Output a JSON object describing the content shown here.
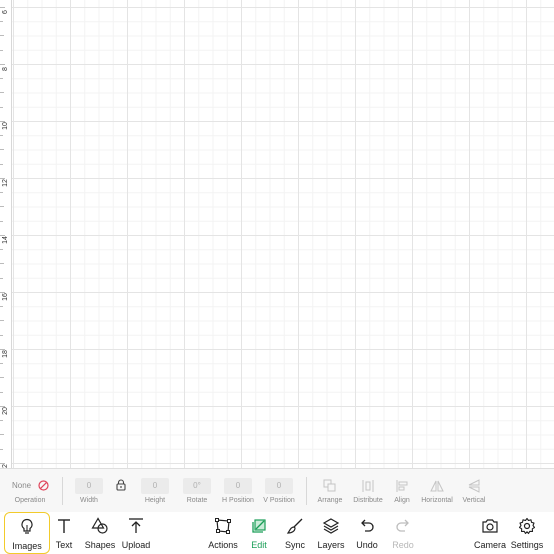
{
  "ruler": {
    "labels": [
      "6",
      "8",
      "10",
      "12",
      "14",
      "16",
      "18",
      "20",
      "2"
    ]
  },
  "properties": {
    "operation": {
      "value": "None",
      "label": "Operation"
    },
    "width": {
      "value": "0",
      "label": "Width"
    },
    "height": {
      "value": "0",
      "label": "Height"
    },
    "rotate": {
      "value": "0°",
      "label": "Rotate"
    },
    "h_position": {
      "value": "0",
      "label": "H Position"
    },
    "v_position": {
      "value": "0",
      "label": "V Position"
    },
    "arrange": {
      "label": "Arrange"
    },
    "distribute": {
      "label": "Distribute"
    },
    "align": {
      "label": "Align"
    },
    "horizontal": {
      "label": "Horizontal"
    },
    "vertical": {
      "label": "Vertical"
    }
  },
  "toolbar": {
    "images": "Images",
    "text": "Text",
    "shapes": "Shapes",
    "upload": "Upload",
    "actions": "Actions",
    "edit": "Edit",
    "sync": "Sync",
    "layers": "Layers",
    "undo": "Undo",
    "redo": "Redo",
    "camera": "Camera",
    "settings": "Settings"
  },
  "colors": {
    "accent_green": "#1a9e57",
    "selected_outline": "#f2cb2b",
    "no_op_red": "#e0455b"
  }
}
